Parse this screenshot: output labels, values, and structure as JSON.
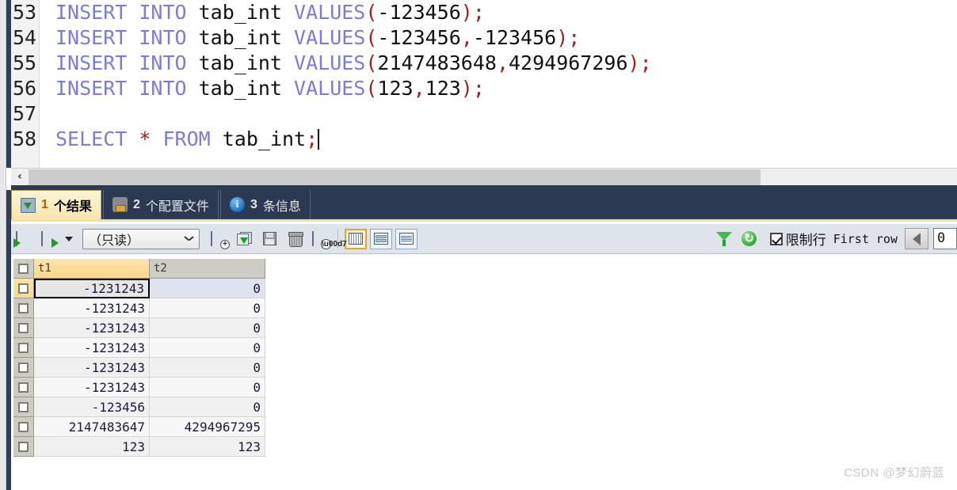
{
  "editor": {
    "lines": [
      {
        "no": "53",
        "tokens": [
          {
            "t": "INSERT INTO ",
            "c": "kw"
          },
          {
            "t": "tab_int ",
            "c": "id"
          },
          {
            "t": "VALUES",
            "c": "kw"
          },
          {
            "t": "(",
            "c": "pn"
          },
          {
            "t": "-123456",
            "c": "num"
          },
          {
            "t": ");",
            "c": "pn"
          }
        ],
        "caret": false
      },
      {
        "no": "54",
        "tokens": [
          {
            "t": "INSERT INTO ",
            "c": "kw"
          },
          {
            "t": "tab_int ",
            "c": "id"
          },
          {
            "t": "VALUES",
            "c": "kw"
          },
          {
            "t": "(",
            "c": "pn"
          },
          {
            "t": "-123456",
            "c": "num"
          },
          {
            "t": ",",
            "c": "pn"
          },
          {
            "t": "-123456",
            "c": "num"
          },
          {
            "t": ");",
            "c": "pn"
          }
        ],
        "caret": false
      },
      {
        "no": "55",
        "tokens": [
          {
            "t": "INSERT INTO ",
            "c": "kw"
          },
          {
            "t": "tab_int ",
            "c": "id"
          },
          {
            "t": "VALUES",
            "c": "kw"
          },
          {
            "t": "(",
            "c": "pn"
          },
          {
            "t": "2147483648",
            "c": "num"
          },
          {
            "t": ",",
            "c": "pn"
          },
          {
            "t": "4294967296",
            "c": "num"
          },
          {
            "t": ");",
            "c": "pn"
          }
        ],
        "caret": false
      },
      {
        "no": "56",
        "tokens": [
          {
            "t": "INSERT INTO ",
            "c": "kw"
          },
          {
            "t": "tab_int ",
            "c": "id"
          },
          {
            "t": "VALUES",
            "c": "kw"
          },
          {
            "t": "(",
            "c": "pn"
          },
          {
            "t": "123",
            "c": "num"
          },
          {
            "t": ",",
            "c": "pn"
          },
          {
            "t": "123",
            "c": "num"
          },
          {
            "t": ");",
            "c": "pn"
          }
        ],
        "caret": false
      },
      {
        "no": "57",
        "tokens": [],
        "caret": false
      },
      {
        "no": "58",
        "tokens": [
          {
            "t": "SELECT ",
            "c": "kw"
          },
          {
            "t": "*",
            "c": "pn"
          },
          {
            "t": " FROM ",
            "c": "kw"
          },
          {
            "t": "tab_int",
            "c": "id"
          },
          {
            "t": ";",
            "c": "pn"
          }
        ],
        "caret": true
      }
    ],
    "hscroll": {
      "left_arrow": "‹"
    }
  },
  "tabs": [
    {
      "icon": "result-grid-icon",
      "num": "1",
      "label": "个结果",
      "active": true
    },
    {
      "icon": "profile-icon",
      "num": "2",
      "label": "个配置文件",
      "active": false
    },
    {
      "icon": "info-icon",
      "num": "3",
      "label": "条信息",
      "active": false
    }
  ],
  "toolbar": {
    "insert_record_title": "插入记录",
    "insert_record_dropdown_title": "插入记录下拉",
    "mode_select_value": "（只读）",
    "add_record_title": "新增",
    "import_title": "导入",
    "save_title": "保存",
    "delete_title": "删除",
    "clear_title": "清除",
    "view_grid_title": "网格视图",
    "view_form_title": "表单视图",
    "view_text_title": "文本视图",
    "filter_title": "筛选",
    "refresh_title": "刷新",
    "limit_rows_label": "限制行",
    "first_row_label": "First row",
    "row_offset_value": "0"
  },
  "grid": {
    "columns": [
      "t1",
      "t2"
    ],
    "selected_column": "t1",
    "selected_cell": {
      "row": 0,
      "column": 0
    },
    "rows": [
      [
        "-1231243",
        "0"
      ],
      [
        "-1231243",
        "0"
      ],
      [
        "-1231243",
        "0"
      ],
      [
        "-1231243",
        "0"
      ],
      [
        "-1231243",
        "0"
      ],
      [
        "-1231243",
        "0"
      ],
      [
        "-123456",
        "0"
      ],
      [
        "2147483647",
        "4294967295"
      ],
      [
        "123",
        "123"
      ]
    ]
  },
  "watermark": {
    "text": "CSDN @梦幻蔚蓝"
  }
}
